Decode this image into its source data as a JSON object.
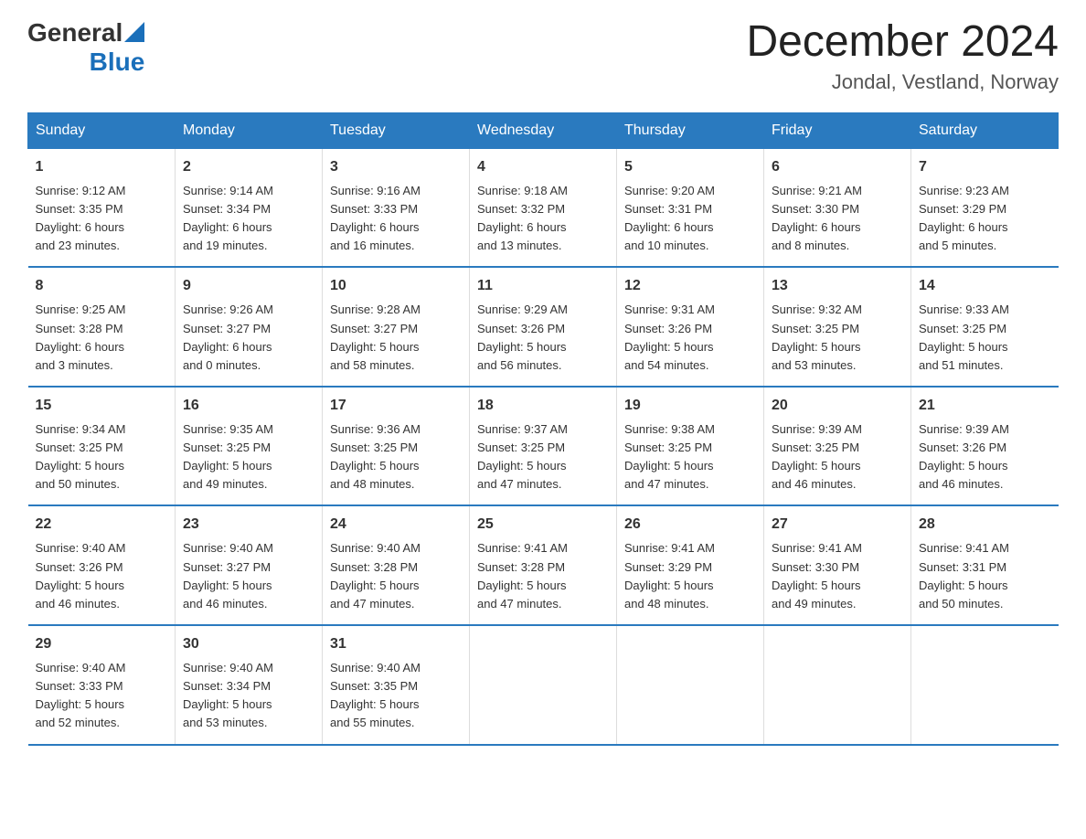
{
  "header": {
    "logo_general": "General",
    "logo_blue": "Blue",
    "month_title": "December 2024",
    "location": "Jondal, Vestland, Norway"
  },
  "weekdays": [
    "Sunday",
    "Monday",
    "Tuesday",
    "Wednesday",
    "Thursday",
    "Friday",
    "Saturday"
  ],
  "weeks": [
    [
      {
        "day": "1",
        "sunrise": "9:12 AM",
        "sunset": "3:35 PM",
        "daylight": "6 hours and 23 minutes."
      },
      {
        "day": "2",
        "sunrise": "9:14 AM",
        "sunset": "3:34 PM",
        "daylight": "6 hours and 19 minutes."
      },
      {
        "day": "3",
        "sunrise": "9:16 AM",
        "sunset": "3:33 PM",
        "daylight": "6 hours and 16 minutes."
      },
      {
        "day": "4",
        "sunrise": "9:18 AM",
        "sunset": "3:32 PM",
        "daylight": "6 hours and 13 minutes."
      },
      {
        "day": "5",
        "sunrise": "9:20 AM",
        "sunset": "3:31 PM",
        "daylight": "6 hours and 10 minutes."
      },
      {
        "day": "6",
        "sunrise": "9:21 AM",
        "sunset": "3:30 PM",
        "daylight": "6 hours and 8 minutes."
      },
      {
        "day": "7",
        "sunrise": "9:23 AM",
        "sunset": "3:29 PM",
        "daylight": "6 hours and 5 minutes."
      }
    ],
    [
      {
        "day": "8",
        "sunrise": "9:25 AM",
        "sunset": "3:28 PM",
        "daylight": "6 hours and 3 minutes."
      },
      {
        "day": "9",
        "sunrise": "9:26 AM",
        "sunset": "3:27 PM",
        "daylight": "6 hours and 0 minutes."
      },
      {
        "day": "10",
        "sunrise": "9:28 AM",
        "sunset": "3:27 PM",
        "daylight": "5 hours and 58 minutes."
      },
      {
        "day": "11",
        "sunrise": "9:29 AM",
        "sunset": "3:26 PM",
        "daylight": "5 hours and 56 minutes."
      },
      {
        "day": "12",
        "sunrise": "9:31 AM",
        "sunset": "3:26 PM",
        "daylight": "5 hours and 54 minutes."
      },
      {
        "day": "13",
        "sunrise": "9:32 AM",
        "sunset": "3:25 PM",
        "daylight": "5 hours and 53 minutes."
      },
      {
        "day": "14",
        "sunrise": "9:33 AM",
        "sunset": "3:25 PM",
        "daylight": "5 hours and 51 minutes."
      }
    ],
    [
      {
        "day": "15",
        "sunrise": "9:34 AM",
        "sunset": "3:25 PM",
        "daylight": "5 hours and 50 minutes."
      },
      {
        "day": "16",
        "sunrise": "9:35 AM",
        "sunset": "3:25 PM",
        "daylight": "5 hours and 49 minutes."
      },
      {
        "day": "17",
        "sunrise": "9:36 AM",
        "sunset": "3:25 PM",
        "daylight": "5 hours and 48 minutes."
      },
      {
        "day": "18",
        "sunrise": "9:37 AM",
        "sunset": "3:25 PM",
        "daylight": "5 hours and 47 minutes."
      },
      {
        "day": "19",
        "sunrise": "9:38 AM",
        "sunset": "3:25 PM",
        "daylight": "5 hours and 47 minutes."
      },
      {
        "day": "20",
        "sunrise": "9:39 AM",
        "sunset": "3:25 PM",
        "daylight": "5 hours and 46 minutes."
      },
      {
        "day": "21",
        "sunrise": "9:39 AM",
        "sunset": "3:26 PM",
        "daylight": "5 hours and 46 minutes."
      }
    ],
    [
      {
        "day": "22",
        "sunrise": "9:40 AM",
        "sunset": "3:26 PM",
        "daylight": "5 hours and 46 minutes."
      },
      {
        "day": "23",
        "sunrise": "9:40 AM",
        "sunset": "3:27 PM",
        "daylight": "5 hours and 46 minutes."
      },
      {
        "day": "24",
        "sunrise": "9:40 AM",
        "sunset": "3:28 PM",
        "daylight": "5 hours and 47 minutes."
      },
      {
        "day": "25",
        "sunrise": "9:41 AM",
        "sunset": "3:28 PM",
        "daylight": "5 hours and 47 minutes."
      },
      {
        "day": "26",
        "sunrise": "9:41 AM",
        "sunset": "3:29 PM",
        "daylight": "5 hours and 48 minutes."
      },
      {
        "day": "27",
        "sunrise": "9:41 AM",
        "sunset": "3:30 PM",
        "daylight": "5 hours and 49 minutes."
      },
      {
        "day": "28",
        "sunrise": "9:41 AM",
        "sunset": "3:31 PM",
        "daylight": "5 hours and 50 minutes."
      }
    ],
    [
      {
        "day": "29",
        "sunrise": "9:40 AM",
        "sunset": "3:33 PM",
        "daylight": "5 hours and 52 minutes."
      },
      {
        "day": "30",
        "sunrise": "9:40 AM",
        "sunset": "3:34 PM",
        "daylight": "5 hours and 53 minutes."
      },
      {
        "day": "31",
        "sunrise": "9:40 AM",
        "sunset": "3:35 PM",
        "daylight": "5 hours and 55 minutes."
      },
      null,
      null,
      null,
      null
    ]
  ],
  "sunrise_label": "Sunrise:",
  "sunset_label": "Sunset:",
  "daylight_label": "Daylight:"
}
